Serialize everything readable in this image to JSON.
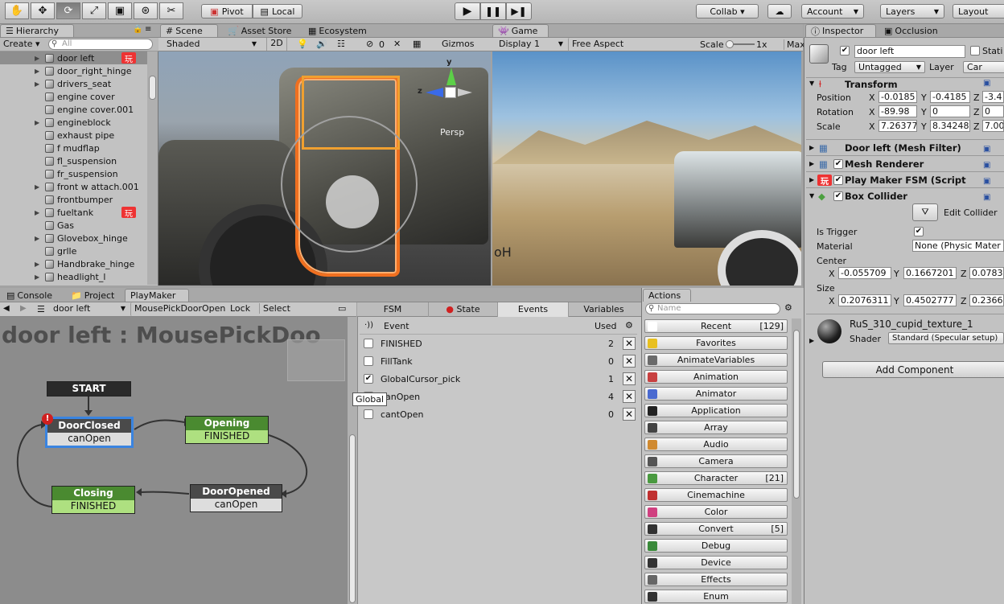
{
  "toolbar": {
    "pivot": "Pivot",
    "local": "Local",
    "collab": "Collab ▾",
    "account": "Account",
    "layers": "Layers",
    "layout": "Layout"
  },
  "hierarchy": {
    "tab": "Hierarchy",
    "create": "Create",
    "search_placeholder": "All",
    "items": [
      {
        "label": "door left",
        "fold": true,
        "pm": true,
        "selected": true
      },
      {
        "label": "door_right_hinge",
        "fold": true,
        "pm": false
      },
      {
        "label": "drivers_seat",
        "fold": true,
        "pm": false
      },
      {
        "label": "engine cover",
        "fold": false,
        "pm": false
      },
      {
        "label": "engine cover.001",
        "fold": false,
        "pm": false
      },
      {
        "label": "engineblock",
        "fold": true,
        "pm": false
      },
      {
        "label": "exhaust pipe",
        "fold": false,
        "pm": false
      },
      {
        "label": "f mudflap",
        "fold": false,
        "pm": false
      },
      {
        "label": "fl_suspension",
        "fold": false,
        "pm": false
      },
      {
        "label": "fr_suspension",
        "fold": false,
        "pm": false
      },
      {
        "label": "front w attach.001",
        "fold": true,
        "pm": false
      },
      {
        "label": "frontbumper",
        "fold": false,
        "pm": false
      },
      {
        "label": "fueltank",
        "fold": true,
        "pm": true
      },
      {
        "label": "Gas",
        "fold": false,
        "pm": false
      },
      {
        "label": "Glovebox_hinge",
        "fold": true,
        "pm": false
      },
      {
        "label": "grlle",
        "fold": false,
        "pm": false
      },
      {
        "label": "Handbrake_hinge",
        "fold": true,
        "pm": false
      },
      {
        "label": "headlight_l",
        "fold": true,
        "pm": false
      }
    ]
  },
  "scene": {
    "tabs": [
      "Scene",
      "Asset Store",
      "Ecosystem"
    ],
    "shaded": "Shaded",
    "mode2d": "2D",
    "counter": "0",
    "gizmos": "Gizmos",
    "persp": "Persp"
  },
  "game": {
    "tab": "Game",
    "display": "Display 1",
    "aspect": "Free Aspect",
    "scale_label": "Scale",
    "scale_value": "1x",
    "max": "Max"
  },
  "bottom_tabs": {
    "console": "Console",
    "project": "Project",
    "playmaker": "PlayMaker"
  },
  "playmaker": {
    "object": "door left",
    "fsm": "MousePickDoorOpen",
    "lock": "Lock",
    "select": "Select",
    "title": "door left : MousePickDoo",
    "nodes": {
      "start": "START",
      "doorclosed": "DoorClosed",
      "doorclosed_event": "canOpen",
      "opening": "Opening",
      "opening_event": "FINISHED",
      "closing": "Closing",
      "closing_event": "FINISHED",
      "dooropened": "DoorOpened",
      "dooropened_event": "canOpen"
    },
    "tabs": [
      "FSM",
      "State",
      "Events",
      "Variables"
    ],
    "events_header": {
      "event": "Event",
      "used": "Used"
    },
    "events": [
      {
        "name": "FINISHED",
        "used": "2",
        "checked": false
      },
      {
        "name": "FillTank",
        "used": "0",
        "checked": false
      },
      {
        "name": "GlobalCursor_pick",
        "used": "1",
        "checked": true
      },
      {
        "name": "canOpen",
        "used": "4",
        "checked": false
      },
      {
        "name": "cantOpen",
        "used": "0",
        "checked": false
      }
    ],
    "tooltip": "Global"
  },
  "actions": {
    "tab": "Actions",
    "search_placeholder": "Name",
    "items": [
      {
        "label": "Recent",
        "count": "[129]",
        "icon": "recent-icon",
        "color": "#ffffff"
      },
      {
        "label": "Favorites",
        "count": "",
        "icon": "star-icon",
        "color": "#e8c020"
      },
      {
        "label": "AnimateVariables",
        "count": "",
        "icon": "grid-icon",
        "color": "#6a6a6a"
      },
      {
        "label": "Animation",
        "count": "",
        "icon": "play-icon",
        "color": "#c84040"
      },
      {
        "label": "Animator",
        "count": "",
        "icon": "animator-icon",
        "color": "#4a6ad0"
      },
      {
        "label": "Application",
        "count": "",
        "icon": "app-icon",
        "color": "#222222"
      },
      {
        "label": "Array",
        "count": "",
        "icon": "array-icon",
        "color": "#444444"
      },
      {
        "label": "Audio",
        "count": "",
        "icon": "audio-icon",
        "color": "#d08a30"
      },
      {
        "label": "Camera",
        "count": "",
        "icon": "camera-icon",
        "color": "#555555"
      },
      {
        "label": "Character",
        "count": "[21]",
        "icon": "character-icon",
        "color": "#4a9a40"
      },
      {
        "label": "Cinemachine",
        "count": "",
        "icon": "cinemachine-icon",
        "color": "#c03030"
      },
      {
        "label": "Color",
        "count": "",
        "icon": "color-icon",
        "color": "#d04080"
      },
      {
        "label": "Convert",
        "count": "[5]",
        "icon": "convert-icon",
        "color": "#333333"
      },
      {
        "label": "Debug",
        "count": "",
        "icon": "debug-icon",
        "color": "#3a8a3a"
      },
      {
        "label": "Device",
        "count": "",
        "icon": "device-icon",
        "color": "#333333"
      },
      {
        "label": "Effects",
        "count": "",
        "icon": "effects-icon",
        "color": "#666666"
      },
      {
        "label": "Enum",
        "count": "",
        "icon": "enum-icon",
        "color": "#333333"
      }
    ]
  },
  "inspector": {
    "tabs": [
      "Inspector",
      "Occlusion"
    ],
    "name": "door left",
    "static": "Stati",
    "tag_label": "Tag",
    "tag": "Untagged",
    "layer_label": "Layer",
    "layer": "Car",
    "transform": {
      "title": "Transform",
      "position": {
        "label": "Position",
        "x": "-0.0185",
        "y": "-0.4185",
        "z": "-3.4"
      },
      "rotation": {
        "label": "Rotation",
        "x": "-89.98",
        "y": "0",
        "z": "0"
      },
      "scale": {
        "label": "Scale",
        "x": "7.26377",
        "y": "8.34248",
        "z": "7.00"
      }
    },
    "components": [
      "Door left (Mesh Filter)",
      "Mesh Renderer",
      "Play Maker FSM (Script",
      "Box Collider"
    ],
    "box": {
      "edit": "Edit Collider",
      "is_trigger": "Is Trigger",
      "material_label": "Material",
      "material": "None (Physic Mater",
      "center": "Center",
      "cx": "-0.055709",
      "cy": "0.1667201",
      "cz": "0.0783",
      "size": "Size",
      "sx": "0.2076311",
      "sy": "0.4502777",
      "sz": "0.2366"
    },
    "material": {
      "name": "RuS_310_cupid_texture_1",
      "shader_label": "Shader",
      "shader": "Standard (Specular setup)"
    },
    "add_component": "Add Component"
  }
}
